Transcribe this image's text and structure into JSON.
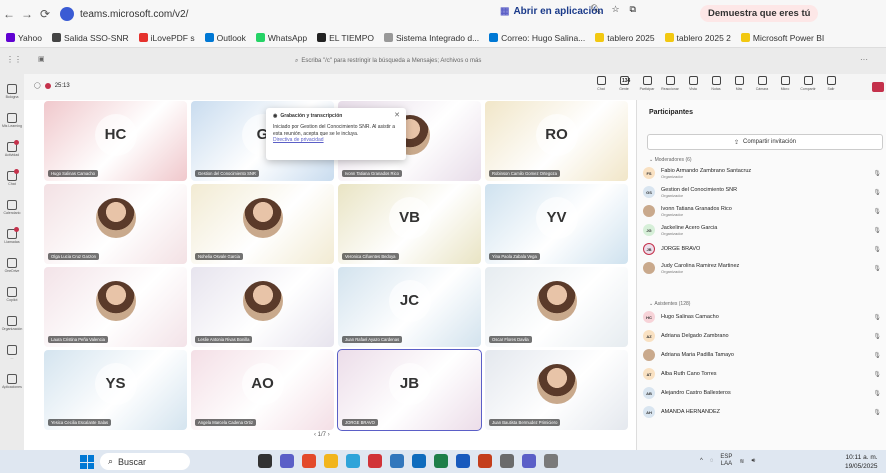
{
  "browser": {
    "url": "teams.microsoft.com/v2/",
    "open_in_app": "Abrir en aplicación",
    "promo": "Demuestra que eres tú"
  },
  "bookmarks": [
    {
      "label": "Yahoo",
      "color": "#6001d2"
    },
    {
      "label": "Salida SSO-SNR",
      "color": "#444444"
    },
    {
      "label": "iLovePDF s",
      "color": "#e5322d"
    },
    {
      "label": "Outlook",
      "color": "#0078d4"
    },
    {
      "label": "WhatsApp",
      "color": "#25d366"
    },
    {
      "label": "EL TIEMPO",
      "color": "#222222"
    },
    {
      "label": "Sistema Integrado d...",
      "color": "#999999"
    },
    {
      "label": "Correo: Hugo Salina...",
      "color": "#0078d4"
    },
    {
      "label": "tablero 2025",
      "color": "#f2c811"
    },
    {
      "label": "tablero 2025 2",
      "color": "#f2c811"
    },
    {
      "label": "Microsoft Power BI",
      "color": "#f2c811"
    }
  ],
  "search": {
    "placeholder": "Escriba \"/c\" para restringir la búsqueda a Mensajes; Archivos o más"
  },
  "rail": [
    {
      "label": "Bologna"
    },
    {
      "label": "Mis Learning"
    },
    {
      "label": "Actividad"
    },
    {
      "label": "Chat"
    },
    {
      "label": "Calendario"
    },
    {
      "label": "Llamadas"
    },
    {
      "label": "OneDrive"
    },
    {
      "label": "Copilot"
    },
    {
      "label": "Organización"
    },
    {
      "label": "..."
    },
    {
      "label": "Aplicaciones"
    }
  ],
  "meeting": {
    "timer": "25:13",
    "participants_count": "134",
    "tools": [
      "Chat",
      "Gente",
      "Participar",
      "Reaccionar",
      "Vista",
      "Notas",
      "Más",
      "Cámara",
      "Micro",
      "Compartir",
      "Salir"
    ]
  },
  "popup": {
    "title": "Grabación y transcripción",
    "body": "Iniciado por Gestion del Conocimiento SNR. Al asistir a esta reunión, acepta que se le incluya.",
    "link": "Directiva de privacidad"
  },
  "tiles": [
    {
      "name": "Hugo Salinas Camacho",
      "initials": "HC",
      "bg": "#f0c8cc"
    },
    {
      "name": "Gestion del Conocimiento SNR",
      "initials": "G",
      "bg": "#c9dcef"
    },
    {
      "name": "Ivonn Tatiana Granados Rico",
      "initials": "",
      "bg": "#e8dde9"
    },
    {
      "name": "Robinson Camilo Gomez Ortegoza",
      "initials": "RO",
      "bg": "#f1e6c8"
    },
    {
      "name": "Olga Lucia Cruz Garzon",
      "initials": "",
      "bg": "#f3e1e4"
    },
    {
      "name": "Nohelia Osvale Garcia",
      "initials": "",
      "bg": "#f2ebd3"
    },
    {
      "name": "Veronica Cifuentes Bedoya",
      "initials": "VB",
      "bg": "#e9e4c4"
    },
    {
      "name": "Yina Paola Zabala Vega",
      "initials": "YV",
      "bg": "#cfe2ef"
    },
    {
      "name": "Laura Cristina Peña Valencia",
      "initials": "",
      "bg": "#f3e3e8"
    },
    {
      "name": "Leslie Antonia Rivas Bonilla",
      "initials": "",
      "bg": "#e7e4ee"
    },
    {
      "name": "Juan Rafael Ayazo Cardenas",
      "initials": "JC",
      "bg": "#d3e3ee"
    },
    {
      "name": "Oscar Flores Davila",
      "initials": "",
      "bg": "#e6ecf0"
    },
    {
      "name": "Yesica Cecilia Escalante Salas",
      "initials": "YS",
      "bg": "#d4e4ef"
    },
    {
      "name": "Angela Marcela Cadena Ortiz",
      "initials": "AO",
      "bg": "#f4dfe6"
    },
    {
      "name": "JORGE BRAVO",
      "initials": "JB",
      "bg": "#ecdde9"
    },
    {
      "name": "Juan Bautista Bermudez Primiciero",
      "initials": "",
      "bg": "#e4e8ee"
    }
  ],
  "pager": "1/7",
  "panel": {
    "title": "Participantes",
    "share": "Compartir invitación",
    "moderators_label": "Moderadores (6)",
    "attendees_label": "Asistentes (128)",
    "moderators": [
      {
        "name": "Fabio Armando Zambrano Santacruz",
        "role": "Organizador",
        "initials": "FS",
        "color": "#f9e1c2"
      },
      {
        "name": "Gestion del Conocimiento SNR",
        "role": "Organizador",
        "initials": "GS",
        "color": "#d9e5f0"
      },
      {
        "name": "Ivonn Tatiana Granados Rico",
        "role": "Organizador",
        "initials": "",
        "color": "#c9a98c"
      },
      {
        "name": "Jackeline Acero Garcia",
        "role": "Organizador",
        "initials": "JG",
        "color": "#d6efd8"
      },
      {
        "name": "JORGE BRAVO",
        "role": "",
        "initials": "JB",
        "color": "#ecdde9"
      },
      {
        "name": "Judy Carolina Ramirez Martinez",
        "role": "Organizador",
        "initials": "",
        "color": "#c9a98c"
      }
    ],
    "attendees": [
      {
        "name": "Hugo Salinas Camacho",
        "initials": "HC",
        "color": "#f7d3d8"
      },
      {
        "name": "Adriana Delgado Zambrano",
        "initials": "AZ",
        "color": "#f9e1c2"
      },
      {
        "name": "Adriana Maria Padilla Tamayo",
        "initials": "",
        "color": "#c9a98c"
      },
      {
        "name": "Alba Ruth Cano Torres",
        "initials": "AT",
        "color": "#f9e1c2"
      },
      {
        "name": "Alejandro Castro Ballesteros",
        "initials": "AB",
        "color": "#d9e5f0"
      },
      {
        "name": "AMANDA HERNANDEZ",
        "initials": "AH",
        "color": "#d9e5f0"
      }
    ]
  },
  "taskbar": {
    "search": "Buscar",
    "lang": "ESP",
    "lang2": "LAA",
    "time": "10:11 a. m.",
    "date": "19/05/2025"
  }
}
